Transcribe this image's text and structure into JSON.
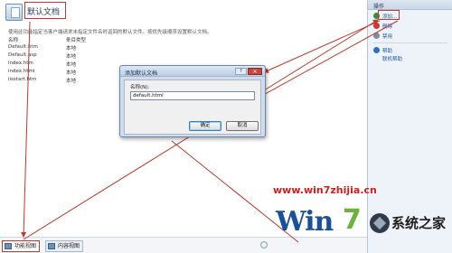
{
  "page": {
    "title": "默认文档",
    "description": "使用此功能指定当客户端请求未指定文件名时返回的默认文件。按优先级顺序设置默认文档。"
  },
  "table": {
    "columns": [
      "名称",
      "条目类型"
    ],
    "rows": [
      {
        "name": "Default.htm",
        "type": "本地"
      },
      {
        "name": "Default.asp",
        "type": "本地"
      },
      {
        "name": "index.htm",
        "type": "本地"
      },
      {
        "name": "index.html",
        "type": "本地"
      },
      {
        "name": "iisstart.htm",
        "type": "本地"
      }
    ]
  },
  "actions": {
    "title": "操作",
    "items": [
      {
        "label": "添加...",
        "icon": "add-icon"
      },
      {
        "label": "删除",
        "icon": "remove-icon"
      },
      {
        "label": "禁用",
        "icon": "disable-icon"
      },
      {
        "label": "帮助",
        "icon": "help-icon"
      },
      {
        "label": "联机帮助",
        "icon": "online-help-icon"
      }
    ]
  },
  "dialog": {
    "title": "添加默认文档",
    "help_glyph": "?",
    "close_glyph": "✕",
    "field_label": "名称(N):",
    "field_value": "default.html",
    "ok_label": "确定",
    "cancel_label": "取消"
  },
  "bottom_tabs": [
    {
      "label": "功能视图",
      "selected": true
    },
    {
      "label": "内容视图",
      "selected": false
    }
  ],
  "watermark": {
    "url": "www.win7zhijia.cn",
    "logo_text_a": "Win",
    "logo_text_b": "7",
    "logo_site": "系统之家"
  },
  "colors": {
    "annotation": "#c0392b",
    "link": "#1a56a8",
    "dialog_frame": "#cfdceb"
  }
}
